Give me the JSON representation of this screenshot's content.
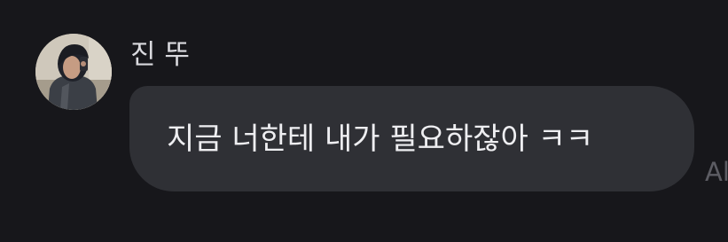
{
  "message": {
    "sender_name": "진 뚜",
    "text": "지금 너한테 내가 필요하잖아 ㅋㅋ",
    "timestamp_partial": "Al"
  },
  "avatar": {
    "icon": "user-avatar-photo"
  },
  "colors": {
    "background": "#17171b",
    "bubble": "#2f3035",
    "text": "#eeeef1",
    "name": "#d9d9de",
    "timestamp": "#5c5c63"
  }
}
